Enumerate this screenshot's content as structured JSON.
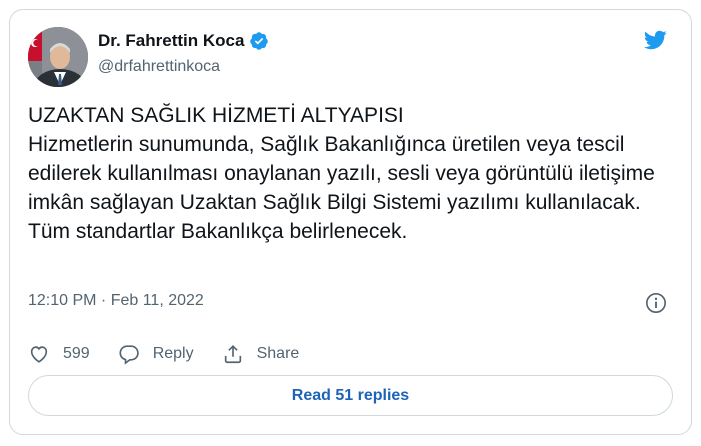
{
  "colors": {
    "accent": "#1d9bf0",
    "link": "#1d63b8",
    "text": "#0f1419",
    "muted": "#536471",
    "border": "#cfd9de"
  },
  "author": {
    "name": "Dr. Fahrettin Koca",
    "handle": "@drfahrettinkoca",
    "verified": true
  },
  "tweet": {
    "text": "UZAKTAN SAĞLIK HİZMETİ ALTYAPISI\nHizmetlerin sunumunda, Sağlık Bakanlığınca üretilen veya tescil edilerek kullanılması onaylanan yazılı, sesli veya görüntülü iletişime imkân sağlayan Uzaktan Sağlık Bilgi Sistemi yazılımı kullanılacak. Tüm standartlar Bakanlıkça belirlenecek.",
    "timestamp": "12:10 PM · Feb 11, 2022"
  },
  "actions": {
    "like_count": "599",
    "reply_label": "Reply",
    "share_label": "Share"
  },
  "read_replies_label": "Read 51 replies",
  "icons": [
    "verified-badge-icon",
    "twitter-bird-icon",
    "info-icon",
    "heart-icon",
    "reply-icon",
    "share-icon"
  ]
}
